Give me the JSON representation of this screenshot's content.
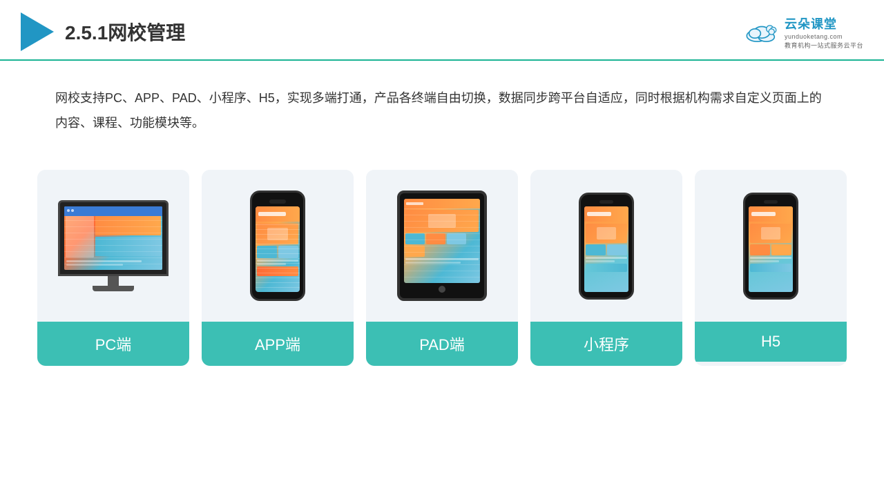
{
  "header": {
    "title": "2.5.1网校管理",
    "logo_main": "云朵课堂",
    "logo_sub": "yunduoketang.com",
    "logo_tagline": "教育机构一站式服务云平台"
  },
  "description": {
    "text": "网校支持PC、APP、PAD、小程序、H5，实现多端打通，产品各终端自由切换，数据同步跨平台自适应，同时根据机构需求自定义页面上的内容、课程、功能模块等。"
  },
  "cards": [
    {
      "id": "pc",
      "label": "PC端"
    },
    {
      "id": "app",
      "label": "APP端"
    },
    {
      "id": "pad",
      "label": "PAD端"
    },
    {
      "id": "miniprogram",
      "label": "小程序"
    },
    {
      "id": "h5",
      "label": "H5"
    }
  ],
  "colors": {
    "accent": "#3cbfb4",
    "header_line": "#1ab394",
    "title": "#333333",
    "text": "#333333",
    "card_bg": "#eef2f7",
    "logo_blue": "#2196c4"
  }
}
